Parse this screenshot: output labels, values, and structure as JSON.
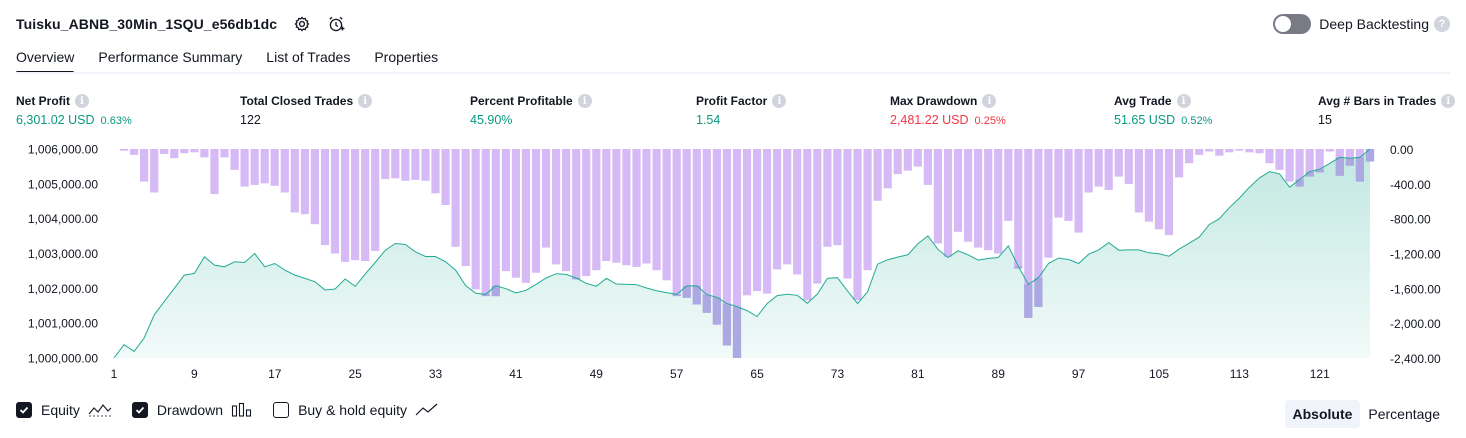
{
  "header": {
    "strategy_name": "Tuisku_ABNB_30Min_1SQU_e56db1dc",
    "settings_icon": "gear-icon",
    "alert_icon": "add-alert-icon",
    "deep_backtesting_label": "Deep Backtesting",
    "deep_backtesting_enabled": false,
    "help_glyph": "?"
  },
  "tabs": [
    {
      "label": "Overview",
      "active": true
    },
    {
      "label": "Performance Summary",
      "active": false
    },
    {
      "label": "List of Trades",
      "active": false
    },
    {
      "label": "Properties",
      "active": false
    }
  ],
  "metrics": {
    "net_profit": {
      "label": "Net Profit",
      "value": "6,301.02 USD",
      "pct": "0.63%"
    },
    "total_closed_trades": {
      "label": "Total Closed Trades",
      "value": "122"
    },
    "percent_profitable": {
      "label": "Percent Profitable",
      "value": "45.90%"
    },
    "profit_factor": {
      "label": "Profit Factor",
      "value": "1.54"
    },
    "max_drawdown": {
      "label": "Max Drawdown",
      "value": "2,481.22 USD",
      "pct": "0.25%"
    },
    "avg_trade": {
      "label": "Avg Trade",
      "value": "51.65 USD",
      "pct": "0.52%"
    },
    "avg_bars": {
      "label": "Avg # Bars in Trades",
      "value": "15"
    }
  },
  "colors": {
    "accent_green": "#089981",
    "accent_red": "#f23645",
    "equity_line": "#22ab94",
    "drawdown_bar": "#d1b3f5",
    "drawdown_overlap": "#a6a6e0",
    "text": "#131722"
  },
  "chart_data": {
    "type": "area",
    "x_ticks": [
      "1",
      "9",
      "17",
      "25",
      "33",
      "41",
      "49",
      "57",
      "65",
      "73",
      "81",
      "89",
      "97",
      "105",
      "113",
      "121"
    ],
    "left_axis": {
      "ticks": [
        "1,006,000.00",
        "1,005,000.00",
        "1,004,000.00",
        "1,003,000.00",
        "1,002,000.00",
        "1,001,000.00",
        "1,000,000.00"
      ],
      "range": [
        1000000,
        1006300
      ]
    },
    "right_axis": {
      "ticks": [
        "0.00",
        "-400.00",
        "-800.00",
        "-1,200.00",
        "-1,600.00",
        "-2,000.00",
        "-2,400.00"
      ],
      "range": [
        -2500,
        0
      ]
    },
    "series": [
      {
        "name": "Equity",
        "values": [
          1000000,
          1000400,
          1000200,
          1000600,
          1001300,
          1001700,
          1002100,
          1002500,
          1002550,
          1003050,
          1002800,
          1002750,
          1002900,
          1002880,
          1003150,
          1002750,
          1002850,
          1002650,
          1002500,
          1002400,
          1002300,
          1002050,
          1002080,
          1002380,
          1002160,
          1002530,
          1002880,
          1003250,
          1003450,
          1003420,
          1003200,
          1003060,
          1003060,
          1002900,
          1002650,
          1002180,
          1001950,
          1001920,
          1002180,
          1002090,
          1001960,
          1002040,
          1002220,
          1002410,
          1002540,
          1002520,
          1002410,
          1002250,
          1002160,
          1002400,
          1002230,
          1002220,
          1002210,
          1002110,
          1002030,
          1001970,
          1001920,
          1002170,
          1002180,
          1001910,
          1001830,
          1001640,
          1001550,
          1001430,
          1001250,
          1001640,
          1001880,
          1001920,
          1001890,
          1001650,
          1001930,
          1002400,
          1002420,
          1002020,
          1001640,
          1002000,
          1002830,
          1002960,
          1003040,
          1003110,
          1003440,
          1003680,
          1003280,
          1003030,
          1003230,
          1003110,
          1002950,
          1003000,
          1003030,
          1003380,
          1002760,
          1002220,
          1002420,
          1002850,
          1003010,
          1002970,
          1002850,
          1003130,
          1003260,
          1003480,
          1003250,
          1003260,
          1003260,
          1003170,
          1003140,
          1003070,
          1003280,
          1003460,
          1003640,
          1004020,
          1004200,
          1004530,
          1004820,
          1005150,
          1005430,
          1005620,
          1005550,
          1005150,
          1005380,
          1005620,
          1005690,
          1005870,
          1006050,
          1006020,
          1006050,
          1006300
        ]
      },
      {
        "name": "Drawdown",
        "values": [
          0,
          -20,
          -70,
          -390,
          -520,
          -60,
          -110,
          -50,
          -40,
          -100,
          -540,
          -100,
          -250,
          -450,
          -430,
          -410,
          -440,
          -520,
          -760,
          -780,
          -900,
          -1150,
          -1250,
          -1350,
          -1330,
          -1340,
          -1220,
          -360,
          -350,
          -380,
          -370,
          -380,
          -530,
          -670,
          -1170,
          -1400,
          -1680,
          -1760,
          -1760,
          -1460,
          -1540,
          -1600,
          -1480,
          -1180,
          -1380,
          -1460,
          -1560,
          -1520,
          -1450,
          -1340,
          -1360,
          -1390,
          -1410,
          -1370,
          -1450,
          -1570,
          -1760,
          -1780,
          -1860,
          -1960,
          -2100,
          -2350,
          -2500,
          -1750,
          -1700,
          -1730,
          -1440,
          -1380,
          -1500,
          -1810,
          -1610,
          -1170,
          -1150,
          -1550,
          -1810,
          -1450,
          -620,
          -470,
          -300,
          -260,
          -210,
          -430,
          -1130,
          -1290,
          -990,
          -1110,
          -1180,
          -1210,
          -1250,
          -860,
          -1430,
          -2020,
          -1890,
          -1300,
          -820,
          -860,
          -1000,
          -520,
          -450,
          -490,
          -330,
          -420,
          -760,
          -870,
          -960,
          -1030,
          -340,
          -170,
          -70,
          -30,
          -80,
          -40,
          -20,
          -40,
          -50,
          -170,
          -250,
          -390,
          -450,
          -330,
          -280,
          -30,
          -320,
          -200,
          -390,
          -150
        ]
      }
    ]
  },
  "legend": [
    {
      "label": "Equity",
      "checked": true,
      "glyph": "equity-line-icon"
    },
    {
      "label": "Drawdown",
      "checked": true,
      "glyph": "drawdown-bars-icon"
    },
    {
      "label": "Buy & hold equity",
      "checked": false,
      "glyph": "buy-hold-line-icon"
    }
  ],
  "modes": [
    {
      "label": "Absolute",
      "active": true
    },
    {
      "label": "Percentage",
      "active": false
    }
  ]
}
